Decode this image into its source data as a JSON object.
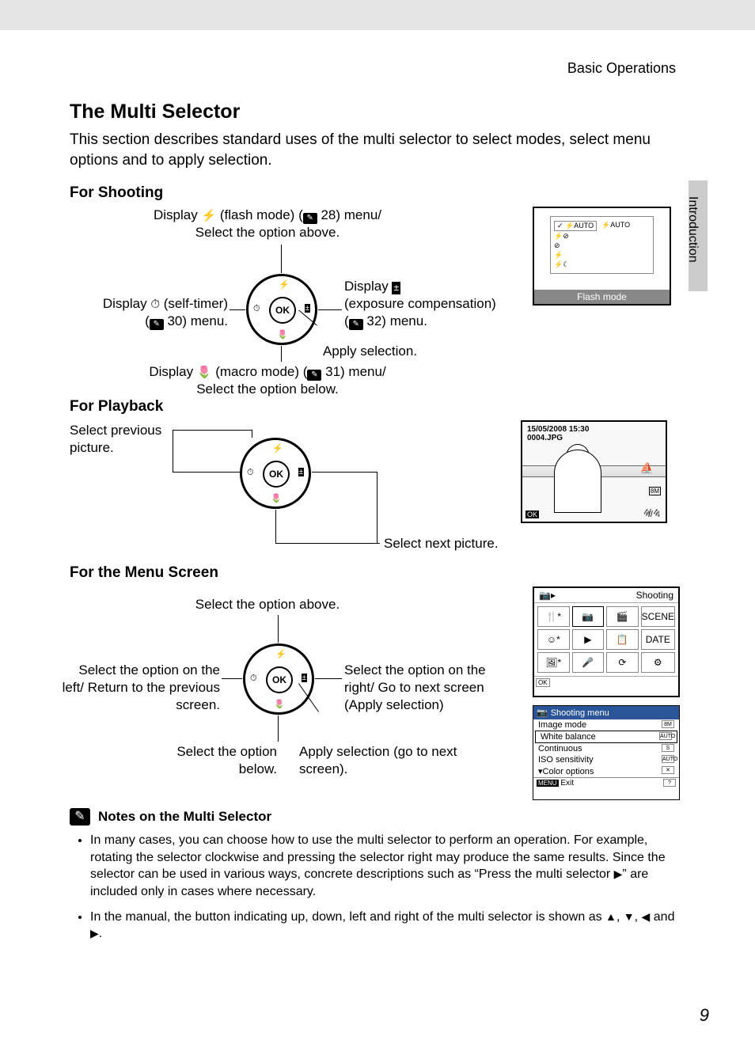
{
  "header": "Basic Operations",
  "side_label": "Introduction",
  "title": "The Multi Selector",
  "intro": "This section describes standard uses of the multi selector to select modes, select menu options and to apply selection.",
  "shooting": {
    "heading": "For Shooting",
    "top_line1_a": "Display ",
    "top_line1_b": " (flash mode) (",
    "top_line1_c": " 28) menu/",
    "top_line2": "Select the option above.",
    "left_line1_a": "Display ",
    "left_line1_b": " (self-timer)",
    "left_line2_a": "(",
    "left_line2_b": " 30) menu.",
    "right1_line1": "Display ",
    "right1_line2": "(exposure compensation)",
    "right1_line3_a": "(",
    "right1_line3_b": " 32) menu.",
    "right2": "Apply selection.",
    "bottom_line1_a": "Display ",
    "bottom_line1_b": " (macro mode) (",
    "bottom_line1_c": " 31) menu/",
    "bottom_line2": "Select the option below.",
    "ok": "OK",
    "flash_caption": "Flash mode",
    "flash_options": [
      "⚡AUTO",
      "⚡AUTO"
    ]
  },
  "playback": {
    "heading": "For Playback",
    "prev": "Select previous picture.",
    "next": "Select next picture.",
    "ok": "OK",
    "timestamp": "15/05/2008 15:30",
    "filename": "0004.JPG",
    "counter": "4/    4"
  },
  "menu": {
    "heading": "For the Menu Screen",
    "top": "Select the option above.",
    "left": "Select the option  on the left/ Return to the previous screen.",
    "right": "Select the option on the right/ Go to next  screen (Apply selection)",
    "bottom": "Select the option below.",
    "apply": "Apply selection (go to next screen).",
    "ok": "OK",
    "grid_title": "Shooting",
    "grid_footer": "OK",
    "sm_title": "Shooting menu",
    "sm_items": [
      {
        "label": "Image mode",
        "val": "8M"
      },
      {
        "label": "White balance",
        "val": "AUTO"
      },
      {
        "label": "Continuous",
        "val": "S"
      },
      {
        "label": "ISO sensitivity",
        "val": "AUTO"
      },
      {
        "label": "Color options",
        "val": "✕"
      }
    ],
    "sm_exit": "Exit",
    "sm_menu": "MENU",
    "sm_help": "?"
  },
  "notes": {
    "title": "Notes on the Multi Selector",
    "item1_a": "In many cases, you can choose how to use the multi selector to perform an operation. For example, rotating the selector clockwise and pressing the selector right may produce the same results. Since the selector can be used in various ways, concrete descriptions such as “Press the multi selector ",
    "item1_b": "” are included only in cases where necessary.",
    "item2_a": "In the manual, the button indicating up, down, left and right of the multi selector is shown as ",
    "item2_b": ", ",
    "item2_c": " and ",
    "item2_d": "."
  },
  "page_number": "9"
}
